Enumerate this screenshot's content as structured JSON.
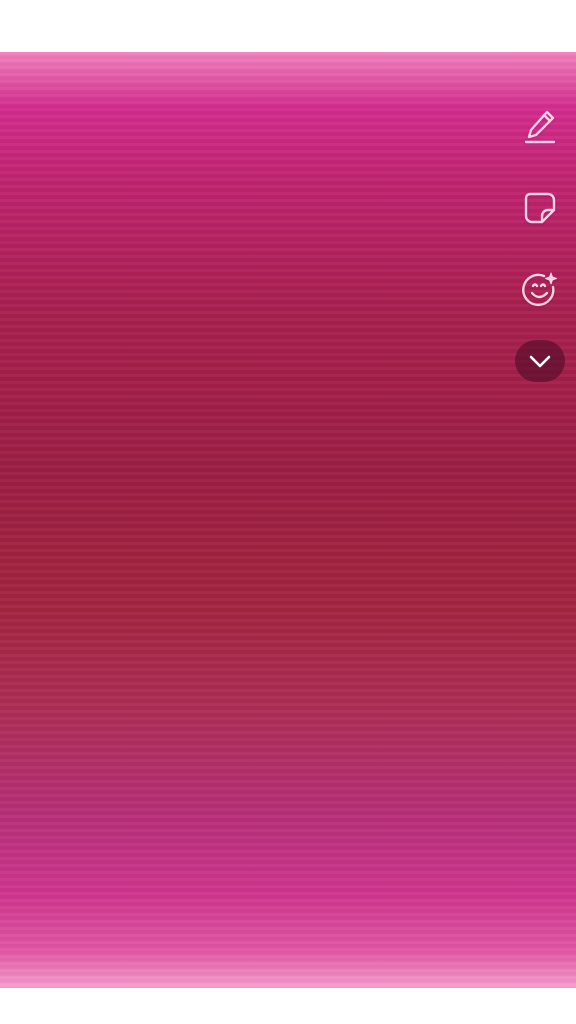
{
  "screen": {
    "background_colors": {
      "top": "#f283bf",
      "middle": "#9d1f45",
      "bottom": "#f7a0cd"
    }
  },
  "tool_rail": {
    "items": [
      {
        "id": "draw",
        "icon": "pencil-icon",
        "color": "#ffd0e8"
      },
      {
        "id": "sticker",
        "icon": "sticker-icon",
        "color": "#ffd0e8"
      },
      {
        "id": "effects",
        "icon": "smiley-sparkle-icon",
        "color": "#ffd0e8"
      }
    ],
    "collapse": {
      "icon": "chevron-down-icon",
      "background": "#5a1430"
    }
  }
}
